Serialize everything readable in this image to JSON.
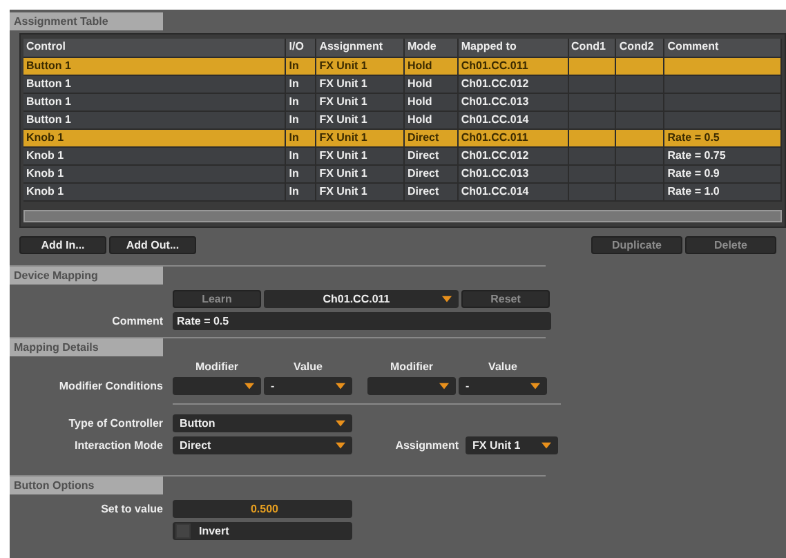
{
  "assignment_table": {
    "title": "Assignment Table",
    "columns": [
      "Control",
      "I/O",
      "Assignment",
      "Mode",
      "Mapped to",
      "Cond1",
      "Cond2",
      "Comment"
    ],
    "rows": [
      {
        "cells": [
          "Button 1",
          "In",
          "FX Unit 1",
          "Hold",
          "Ch01.CC.011",
          "",
          "",
          ""
        ],
        "selected": true
      },
      {
        "cells": [
          "Button 1",
          "In",
          "FX Unit 1",
          "Hold",
          "Ch01.CC.012",
          "",
          "",
          ""
        ],
        "selected": false
      },
      {
        "cells": [
          "Button 1",
          "In",
          "FX Unit 1",
          "Hold",
          "Ch01.CC.013",
          "",
          "",
          ""
        ],
        "selected": false
      },
      {
        "cells": [
          "Button 1",
          "In",
          "FX Unit 1",
          "Hold",
          "Ch01.CC.014",
          "",
          "",
          ""
        ],
        "selected": false
      },
      {
        "cells": [
          "Knob 1",
          "In",
          "FX Unit 1",
          "Direct",
          "Ch01.CC.011",
          "",
          "",
          "Rate = 0.5"
        ],
        "selected": true
      },
      {
        "cells": [
          "Knob 1",
          "In",
          "FX Unit 1",
          "Direct",
          "Ch01.CC.012",
          "",
          "",
          "Rate = 0.75"
        ],
        "selected": false
      },
      {
        "cells": [
          "Knob 1",
          "In",
          "FX Unit 1",
          "Direct",
          "Ch01.CC.013",
          "",
          "",
          "Rate = 0.9"
        ],
        "selected": false
      },
      {
        "cells": [
          "Knob 1",
          "In",
          "FX Unit 1",
          "Direct",
          "Ch01.CC.014",
          "",
          "",
          "Rate = 1.0"
        ],
        "selected": false
      }
    ],
    "left_buttons": [
      {
        "label": "Add In...",
        "disabled": false
      },
      {
        "label": "Add Out...",
        "disabled": false
      }
    ],
    "right_buttons": [
      {
        "label": "Duplicate",
        "disabled": true
      },
      {
        "label": "Delete",
        "disabled": true
      }
    ]
  },
  "device_mapping": {
    "title": "Device Mapping",
    "learn": {
      "label": "Learn",
      "disabled": true
    },
    "mapped_to": "Ch01.CC.011",
    "reset": {
      "label": "Reset",
      "disabled": true
    },
    "comment_label": "Comment",
    "comment": "Rate = 0.5"
  },
  "mapping_details": {
    "title": "Mapping Details",
    "modifier_label": "Modifier Conditions",
    "conditions": [
      {
        "modifier_heading": "Modifier",
        "value_heading": "Value",
        "value": "-"
      },
      {
        "modifier_heading": "Modifier",
        "value_heading": "Value",
        "value": "-"
      }
    ],
    "type_label": "Type of Controller",
    "type": "Button",
    "interaction_label": "Interaction Mode",
    "interaction": "Direct",
    "assignment_label": "Assignment",
    "assignment": "FX Unit 1"
  },
  "button_options": {
    "title": "Button Options",
    "set_label": "Set to value",
    "set_value": "0.500",
    "invert": {
      "label": "Invert",
      "checked": false
    }
  }
}
